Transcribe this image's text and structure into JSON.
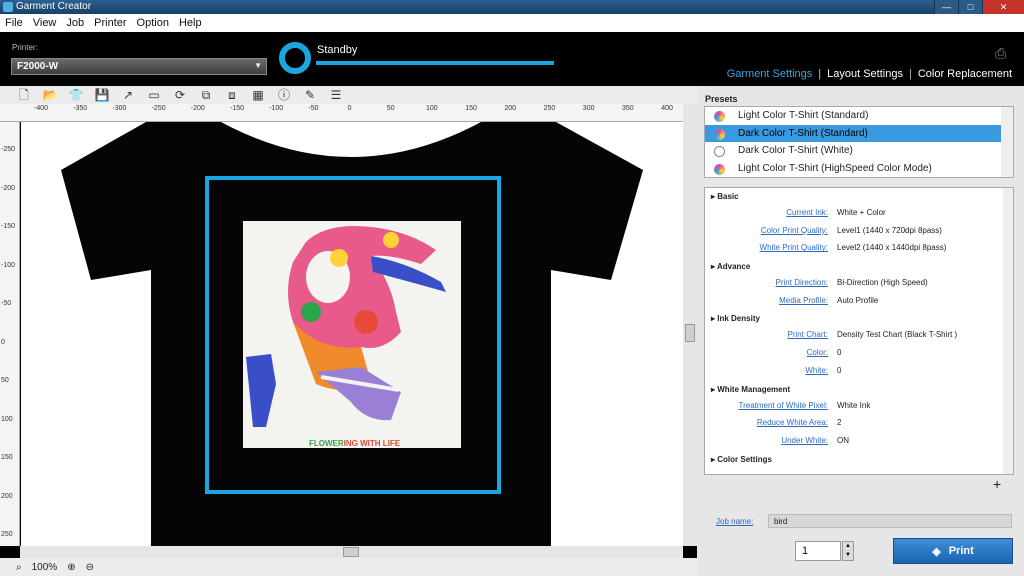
{
  "window": {
    "title": "Garment Creator",
    "min": "—",
    "max": "□",
    "close": "✕"
  },
  "menu": [
    "File",
    "View",
    "Job",
    "Printer",
    "Option",
    "Help"
  ],
  "header": {
    "printer_label": "Printer:",
    "printer_value": "F2000-W",
    "status": "Standby",
    "tabs": [
      "Garment Settings",
      "Layout Settings",
      "Color Replacement"
    ],
    "tab_sep": "|"
  },
  "ruler_top": [
    "-400",
    "-350",
    "-300",
    "-250",
    "-200",
    "-150",
    "-100",
    "-50",
    "0",
    "50",
    "100",
    "150",
    "200",
    "250",
    "300",
    "350",
    "400"
  ],
  "ruler_left": [
    "-250",
    "-200",
    "-150",
    "-100",
    "-50",
    "0",
    "50",
    "100",
    "150",
    "200",
    "250"
  ],
  "artwork_caption": {
    "part1": "FLOWER",
    "part2": "ING WITH LIFE"
  },
  "status": {
    "zoom": "100%"
  },
  "presets": {
    "label": "Presets",
    "items": [
      {
        "label": "Light Color T-Shirt (Standard)",
        "selected": false,
        "icon": "color-ink-icon"
      },
      {
        "label": "Dark Color T-Shirt (Standard)",
        "selected": true,
        "icon": "color-ink-icon"
      },
      {
        "label": "Dark Color T-Shirt (White)",
        "selected": false,
        "icon": "white-ink-icon"
      },
      {
        "label": "Light Color T-Shirt (HighSpeed Color Mode)",
        "selected": false,
        "icon": "color-x2-icon"
      }
    ]
  },
  "settings": {
    "basic": {
      "title": "Basic",
      "rows": [
        {
          "k": "Current Ink:",
          "v": "White + Color"
        },
        {
          "k": "Color Print Quality:",
          "v": "Level1 (1440 x 720dpi 8pass)"
        },
        {
          "k": "White Print Quality:",
          "v": "Level2 (1440 x 1440dpi 8pass)"
        }
      ]
    },
    "advance": {
      "title": "Advance",
      "rows": [
        {
          "k": "Print Direction:",
          "v": "Bi-Direction (High Speed)"
        },
        {
          "k": "Media Profile:",
          "v": "Auto Profile"
        }
      ]
    },
    "ink_density": {
      "title": "Ink Density",
      "rows": [
        {
          "k": "Print Chart:",
          "v": "Density Test Chart (Black T-Shirt )"
        },
        {
          "k": "Color:",
          "v": "0"
        },
        {
          "k": "White:",
          "v": "0"
        }
      ]
    },
    "white_mgmt": {
      "title": "White Management",
      "rows": [
        {
          "k": "Treatment of White Pixel:",
          "v": "White Ink"
        },
        {
          "k": "Reduce White Area:",
          "v": "2"
        },
        {
          "k": "Under White:",
          "v": "ON"
        }
      ]
    },
    "color_settings": {
      "title": "Color Settings"
    }
  },
  "job": {
    "name_label": "Job name:",
    "name_value": "bird",
    "copies": "1",
    "print_label": "Print"
  },
  "colors": {
    "accent": "#1aa6e0",
    "link": "#2a6bbf",
    "selected": "#3a9ae0"
  }
}
